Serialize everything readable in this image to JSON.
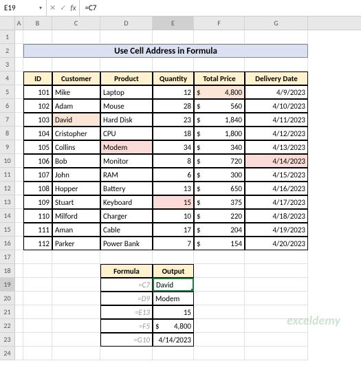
{
  "nameBox": "E19",
  "formulaBar": "=C7",
  "icons": {
    "cancel": "✕",
    "confirm": "✓",
    "fx": "fx",
    "dropdown": "▾"
  },
  "columns": [
    "A",
    "B",
    "C",
    "D",
    "E",
    "F",
    "G"
  ],
  "rows": [
    "1",
    "2",
    "3",
    "4",
    "5",
    "6",
    "7",
    "8",
    "9",
    "10",
    "11",
    "12",
    "13",
    "14",
    "15",
    "16",
    "17",
    "18",
    "19",
    "20",
    "21",
    "22",
    "23",
    "24"
  ],
  "title": "Use Cell Address in Formula",
  "headers": {
    "id": "ID",
    "customer": "Customer",
    "product": "Product",
    "quantity": "Quantity",
    "price": "Total Price",
    "delivery": "Delivery Date"
  },
  "data": [
    {
      "id": "101",
      "customer": "Mike",
      "product": "Laptop",
      "qty": "12",
      "price": "4,800",
      "date": "4/9/2023"
    },
    {
      "id": "102",
      "customer": "Adam",
      "product": "Mouse",
      "qty": "28",
      "price": "560",
      "date": "4/10/2023"
    },
    {
      "id": "103",
      "customer": "David",
      "product": "Hard Disk",
      "qty": "23",
      "price": "1,840",
      "date": "4/11/2023"
    },
    {
      "id": "104",
      "customer": "Cristopher",
      "product": "CPU",
      "qty": "18",
      "price": "1,800",
      "date": "4/12/2023"
    },
    {
      "id": "105",
      "customer": "Collins",
      "product": "Modem",
      "qty": "34",
      "price": "340",
      "date": "4/13/2023"
    },
    {
      "id": "106",
      "customer": "Bob",
      "product": "Monitor",
      "qty": "8",
      "price": "720",
      "date": "4/14/2023"
    },
    {
      "id": "107",
      "customer": "John",
      "product": "RAM",
      "qty": "6",
      "price": "300",
      "date": "4/15/2023"
    },
    {
      "id": "108",
      "customer": "Hopper",
      "product": "Battery",
      "qty": "13",
      "price": "650",
      "date": "4/16/2023"
    },
    {
      "id": "109",
      "customer": "Stuart",
      "product": "Keyboard",
      "qty": "15",
      "price": "375",
      "date": "4/17/2023"
    },
    {
      "id": "110",
      "customer": "Milford",
      "product": "Charger",
      "qty": "10",
      "price": "220",
      "date": "4/18/2023"
    },
    {
      "id": "111",
      "customer": "Aman",
      "product": "Cable",
      "qty": "17",
      "price": "204",
      "date": "4/19/2023"
    },
    {
      "id": "112",
      "customer": "Parker",
      "product": "Power Bank",
      "qty": "7",
      "price": "154",
      "date": "4/20/2023"
    }
  ],
  "formulaHeaders": {
    "f": "Formula",
    "o": "Output"
  },
  "formulas": [
    {
      "f": "=C7",
      "o": "David",
      "type": "text"
    },
    {
      "f": "=D9",
      "o": "Modem",
      "type": "text"
    },
    {
      "f": "=E13",
      "o": "15",
      "type": "num"
    },
    {
      "f": "=F5",
      "o": "4,800",
      "type": "price"
    },
    {
      "f": "=G10",
      "o": "4/14/2023",
      "type": "date"
    }
  ],
  "currency": "$",
  "watermark": "exceldemy"
}
